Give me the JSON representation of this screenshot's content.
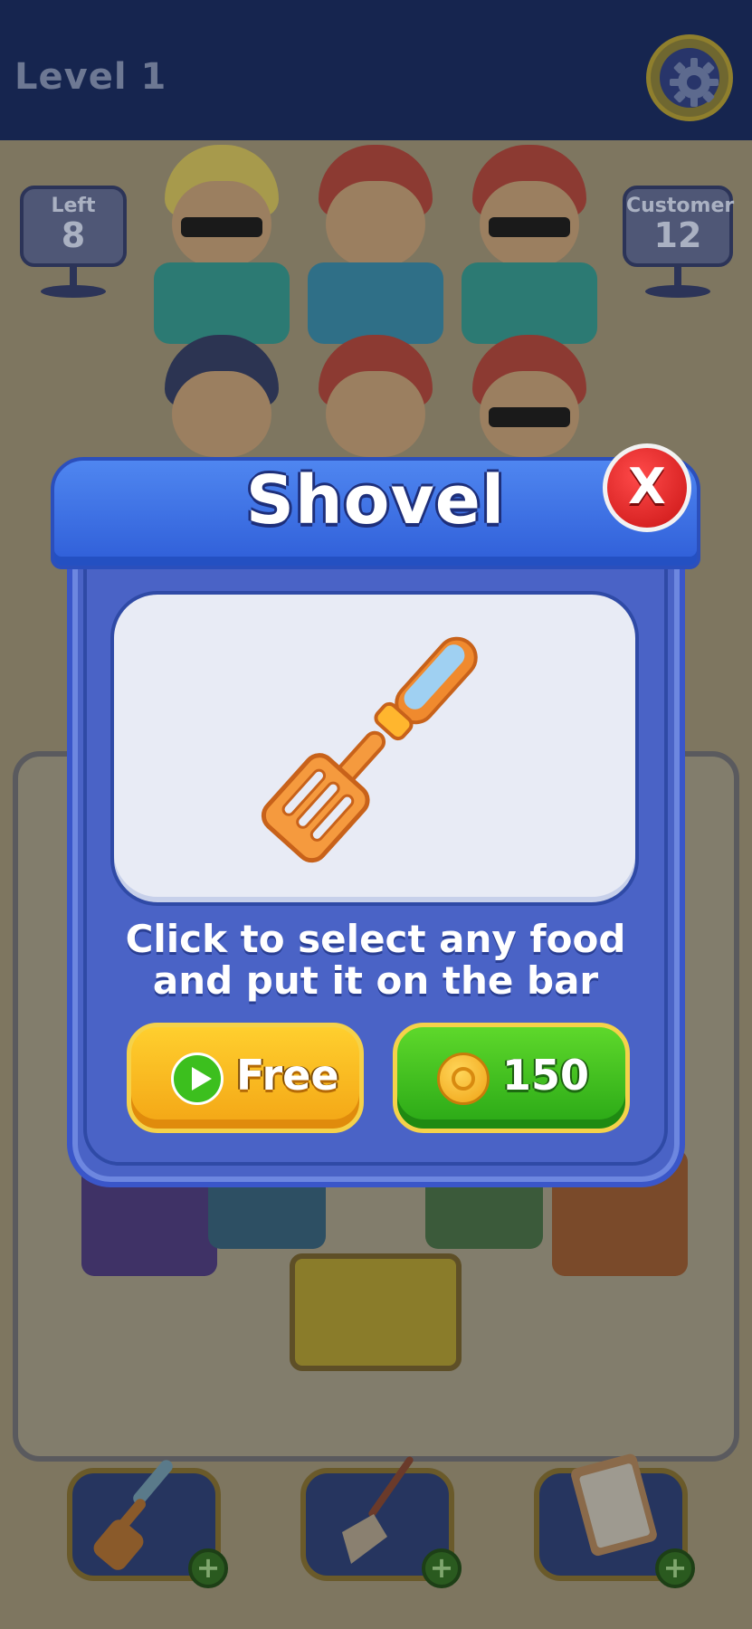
{
  "header": {
    "level_label": "Level 1",
    "settings_icon": "gear-icon"
  },
  "counters": {
    "left": {
      "label": "Left",
      "value": "8"
    },
    "customer": {
      "label": "Customer",
      "value": "12"
    }
  },
  "modal": {
    "title": "Shovel",
    "close_label": "X",
    "item_icon": "spatula-icon",
    "description": "Click to select any food and put it on the bar",
    "free_button": {
      "label": "Free",
      "icon": "play-icon"
    },
    "coin_button": {
      "label": "150",
      "icon": "coin-icon"
    }
  },
  "tools": [
    {
      "name": "shovel",
      "icon": "spatula-icon",
      "badge": "+"
    },
    {
      "name": "broom",
      "icon": "broom-icon",
      "badge": "+"
    },
    {
      "name": "checklist",
      "icon": "clipboard-icon",
      "badge": "+"
    }
  ],
  "colors": {
    "modal_blue": "#4a63c6",
    "header_blue": "#3a6ee0",
    "close_red": "#d91c1c",
    "free_yellow": "#f8bb1e",
    "coin_green": "#3cbf1e"
  }
}
